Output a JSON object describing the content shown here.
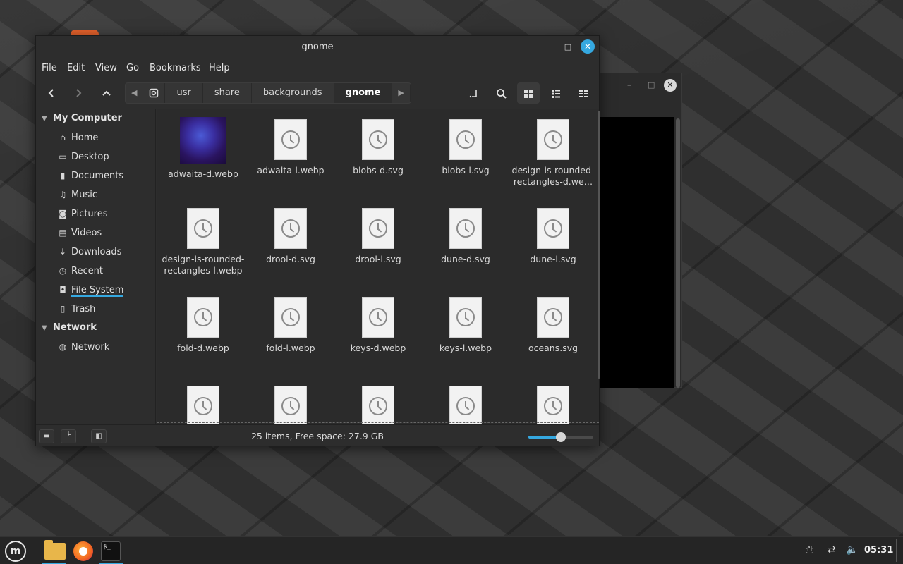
{
  "window": {
    "title": "gnome",
    "close_glyph": "✕",
    "min_glyph": "–",
    "max_glyph": "□"
  },
  "menu": [
    "File",
    "Edit",
    "View",
    "Go",
    "Bookmarks",
    "Help"
  ],
  "breadcrumbs": [
    "usr",
    "share",
    "backgrounds",
    "gnome"
  ],
  "sidebar": {
    "sections": [
      {
        "title": "My Computer",
        "items": [
          {
            "label": "Home",
            "icon": "home-icon"
          },
          {
            "label": "Desktop",
            "icon": "desktop-icon"
          },
          {
            "label": "Documents",
            "icon": "document-icon"
          },
          {
            "label": "Music",
            "icon": "music-icon"
          },
          {
            "label": "Pictures",
            "icon": "camera-icon"
          },
          {
            "label": "Videos",
            "icon": "film-icon"
          },
          {
            "label": "Downloads",
            "icon": "download-icon"
          },
          {
            "label": "Recent",
            "icon": "recent-icon"
          },
          {
            "label": "File System",
            "icon": "drive-icon",
            "selected": true
          },
          {
            "label": "Trash",
            "icon": "trash-icon"
          }
        ]
      },
      {
        "title": "Network",
        "items": [
          {
            "label": "Network",
            "icon": "globe-icon"
          }
        ]
      }
    ]
  },
  "files": [
    {
      "name": "adwaita-d.webp",
      "thumb": "image"
    },
    {
      "name": "adwaita-l.webp",
      "thumb": "clock"
    },
    {
      "name": "blobs-d.svg",
      "thumb": "clock"
    },
    {
      "name": "blobs-l.svg",
      "thumb": "clock"
    },
    {
      "name": "design-is-rounded-rectangles-d.we…",
      "thumb": "clock"
    },
    {
      "name": "design-is-rounded-rectangles-l.webp",
      "thumb": "clock"
    },
    {
      "name": "drool-d.svg",
      "thumb": "clock"
    },
    {
      "name": "drool-l.svg",
      "thumb": "clock"
    },
    {
      "name": "dune-d.svg",
      "thumb": "clock"
    },
    {
      "name": "dune-l.svg",
      "thumb": "clock"
    },
    {
      "name": "fold-d.webp",
      "thumb": "clock"
    },
    {
      "name": "fold-l.webp",
      "thumb": "clock"
    },
    {
      "name": "keys-d.webp",
      "thumb": "clock"
    },
    {
      "name": "keys-l.webp",
      "thumb": "clock"
    },
    {
      "name": "oceans.svg",
      "thumb": "clock"
    },
    {
      "name": "",
      "thumb": "clock"
    },
    {
      "name": "",
      "thumb": "clock"
    },
    {
      "name": "",
      "thumb": "clock"
    },
    {
      "name": "",
      "thumb": "clock"
    },
    {
      "name": "",
      "thumb": "clock"
    }
  ],
  "status": {
    "text": "25 items, Free space: 27.9 GB",
    "zoom_level": 0.5
  },
  "taskbar": {
    "clock": "05:31",
    "accent": "#35a8e0",
    "apps": [
      "menu-icon",
      "files-icon",
      "firefox-icon",
      "terminal-icon"
    ],
    "terminal_glyph": "$_"
  }
}
